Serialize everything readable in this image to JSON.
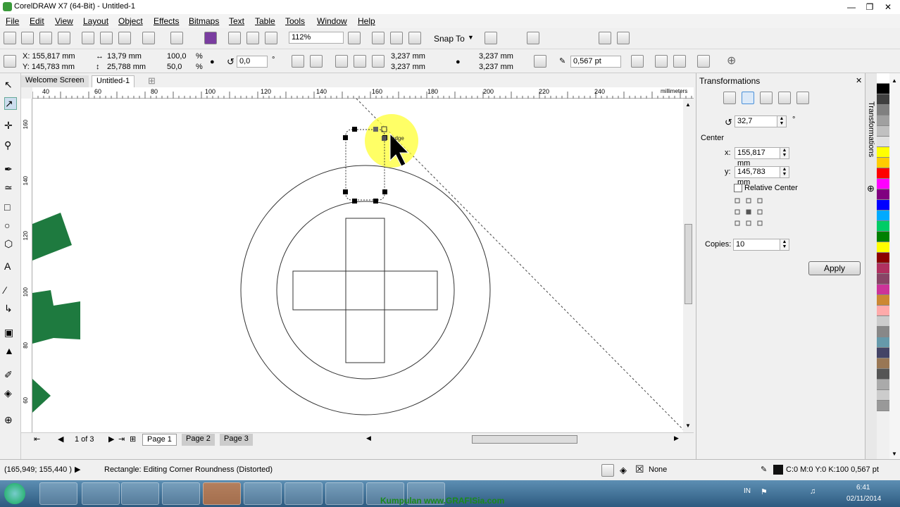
{
  "app": {
    "title": "CorelDRAW X7 (64-Bit) - Untitled-1"
  },
  "menu": [
    "File",
    "Edit",
    "View",
    "Layout",
    "Object",
    "Effects",
    "Bitmaps",
    "Text",
    "Table",
    "Tools",
    "Window",
    "Help"
  ],
  "toolbar1": {
    "zoom": "112%",
    "snap_to": "Snap To"
  },
  "property_bar": {
    "x": "X: 155,817 mm",
    "y": "Y: 145,783 mm",
    "width": "13,79 mm",
    "height": "25,788 mm",
    "scale_w": "100,0",
    "scale_h": "50,0",
    "percent": "%",
    "rotation": "0,0",
    "degree": "°",
    "corner_tl": "3,237 mm",
    "corner_bl": "3,237 mm",
    "corner_tr": "3,237 mm",
    "corner_br": "3,237 mm",
    "outline_width": "0,567 pt"
  },
  "doc_tabs": {
    "welcome": "Welcome Screen",
    "current": "Untitled-1"
  },
  "ruler": {
    "h_ticks": [
      "40",
      "60",
      "80",
      "100",
      "120",
      "140",
      "160",
      "180",
      "200",
      "220",
      "240"
    ],
    "units": "millimeters",
    "v_ticks": [
      "160",
      "140",
      "120",
      "100",
      "80",
      "60"
    ]
  },
  "canvas": {
    "snap_label": "edge"
  },
  "pages": {
    "counter": "1 of 3",
    "tabs": [
      "Page 1",
      "Page 2",
      "Page 3"
    ]
  },
  "docker": {
    "title": "Transformations",
    "angle": "32,7",
    "degree": "°",
    "center_label": "Center",
    "x_label": "x:",
    "x_value": "155,817 mm",
    "y_label": "y:",
    "y_value": "145,783 mm",
    "relative_center": "Relative Center",
    "copies_label": "Copies:",
    "copies_value": "10",
    "apply": "Apply",
    "side_tab": "Transformations"
  },
  "palette_colors": [
    "#ffffff",
    "#000000",
    "#404040",
    "#808080",
    "#a0a0a0",
    "#c0c0c0",
    "#e0e0e0",
    "#ffff00",
    "#ffcc00",
    "#ff0000",
    "#ff00ff",
    "#800080",
    "#0000ff",
    "#00aaff",
    "#00cc66",
    "#008000",
    "#ffff00",
    "#8b0000",
    "#b03060",
    "#884466",
    "#cc3399",
    "#cc8833",
    "#ffaaaa",
    "#cccccc",
    "#888888",
    "#6699aa",
    "#444466",
    "#997755",
    "#555555",
    "#aaaaaa",
    "#cccccc",
    "#999999"
  ],
  "status": {
    "coords": "(165,949; 155,440 )",
    "message": "Rectangle: Editing Corner Roundness (Distorted)",
    "fill": "None",
    "outline": "C:0 M:0 Y:0 K:100  0,567 pt"
  },
  "taskbar": {
    "watermark": "Kumpulan www.GRAFISia.com",
    "lang": "IN",
    "time": "6:41",
    "date": "02/11/2014"
  }
}
